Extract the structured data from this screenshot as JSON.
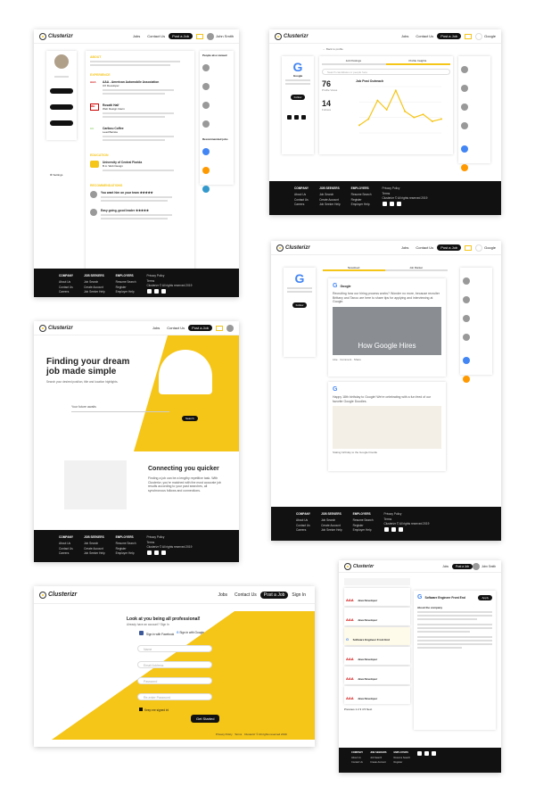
{
  "nav": {
    "logo": "Clusterizr",
    "jobs": "Jobs",
    "contact": "Contact Us",
    "post": "Post a Job",
    "signin": "Sign In",
    "user": "John Smith",
    "company": "Google"
  },
  "footer": {
    "company": {
      "title": "COMPANY",
      "items": [
        "About Us",
        "Contact Us",
        "Careers"
      ]
    },
    "seekers": {
      "title": "JOB SEEKERS",
      "items": [
        "Job Search",
        "Create Account",
        "Job Seeker Help"
      ]
    },
    "employers": {
      "title": "EMPLOYERS",
      "items": [
        "Resume Search",
        "Register",
        "Employer Help"
      ]
    },
    "legal": {
      "privacy": "Privacy Policy",
      "terms": "Terms",
      "rights": "Clusterizr © All rights reserved 2019"
    }
  },
  "profile": {
    "about": "ABOUT",
    "experience": "EXPERIENCE",
    "education": "EDUCATION",
    "recommendations": "RECOMMENDATIONS",
    "jobs": [
      {
        "title": "AAA - American Automobile Association",
        "role": "UX Developer",
        "logo": "AAA"
      },
      {
        "title": "Rosatti Half",
        "role": "Web Design Intern",
        "logo": "RH"
      },
      {
        "title": "Caribou Coffee",
        "role": "Lead Barista",
        "logo": "CC"
      }
    ],
    "school": {
      "name": "University of Central Florida",
      "degree": "B.A. Web Design"
    },
    "reviews": [
      {
        "title": "You want him on your team ★★★★★"
      },
      {
        "title": "Easy going, good leader ★★★★★"
      }
    ],
    "settings": "Settings",
    "people": "People also viewed",
    "recommended": "Recommended jobs"
  },
  "dashboard": {
    "back": "Back to profile",
    "tab1": "Job Postings",
    "tab2": "Profile Insights",
    "search_ph": "Search candidates or people here",
    "stat1": {
      "value": "76",
      "label": "Profile Views"
    },
    "stat2": {
      "value": "14",
      "label": "Follows"
    },
    "chart_title": "Job Post Outreach",
    "company": "Google",
    "follow": "Follow"
  },
  "chart_data": {
    "type": "line",
    "title": "Job Post Outreach",
    "categories": [],
    "values": [
      10,
      18,
      42,
      30,
      55,
      28,
      20,
      24,
      15,
      18
    ],
    "xlabel": "",
    "ylabel": ""
  },
  "feed": {
    "tab1": "Newsfeed",
    "tab2": "Job Market",
    "company": "Google",
    "post1": "Recruiting how our hiring process works? Wonder no more, because recruiter Brittany and Tanoo are here to share tips for applying and interviewing at Google.",
    "video_title": "How Google Hires",
    "post2": "Happy 18th birthday to Google! We're celebrating with a fun feed of our favorite Google Doodles.",
    "caption": "Stating birthday to the Google Doodle",
    "like": "Like",
    "comment": "Comment",
    "share": "Share"
  },
  "landing": {
    "hero": "Finding your dream job made simple",
    "sub": "Search your desired position, title and location highlights.",
    "search_ph": "Your future awaits",
    "search_btn": "Search",
    "connect": "Connecting you quicker",
    "connect_text": "Finding a job can be a lengthy repetitive task. With Clusterizr, you're matched with the most accurate job results according to your past searches, all synchronous follows and connections."
  },
  "signup": {
    "title": "Look at you being all professional!",
    "already": "Already have an account? Sign In",
    "fb": "Sign in with Facebook",
    "google": "Sign in with Google",
    "fields": [
      "Name",
      "Email Address",
      "Password",
      "Re-enter Password"
    ],
    "remember": "Keep me signed in!",
    "submit": "Get Started",
    "privacy": "Privacy Policy",
    "terms": "Terms"
  },
  "jobsearch": {
    "listings": [
      {
        "title": "Java Developer"
      },
      {
        "title": "Java Developer"
      },
      {
        "title": "Software Engineer Front End"
      },
      {
        "title": "Java Developer"
      },
      {
        "title": "Java Developer"
      },
      {
        "title": "Java Developer"
      }
    ],
    "detail_title": "Software Engineer Front End",
    "apply": "Apply",
    "about": "About the company",
    "pages": "Previous 1 2 3 4 5 Next"
  },
  "colors": {
    "accent": "#f5c518",
    "dark": "#111111"
  }
}
